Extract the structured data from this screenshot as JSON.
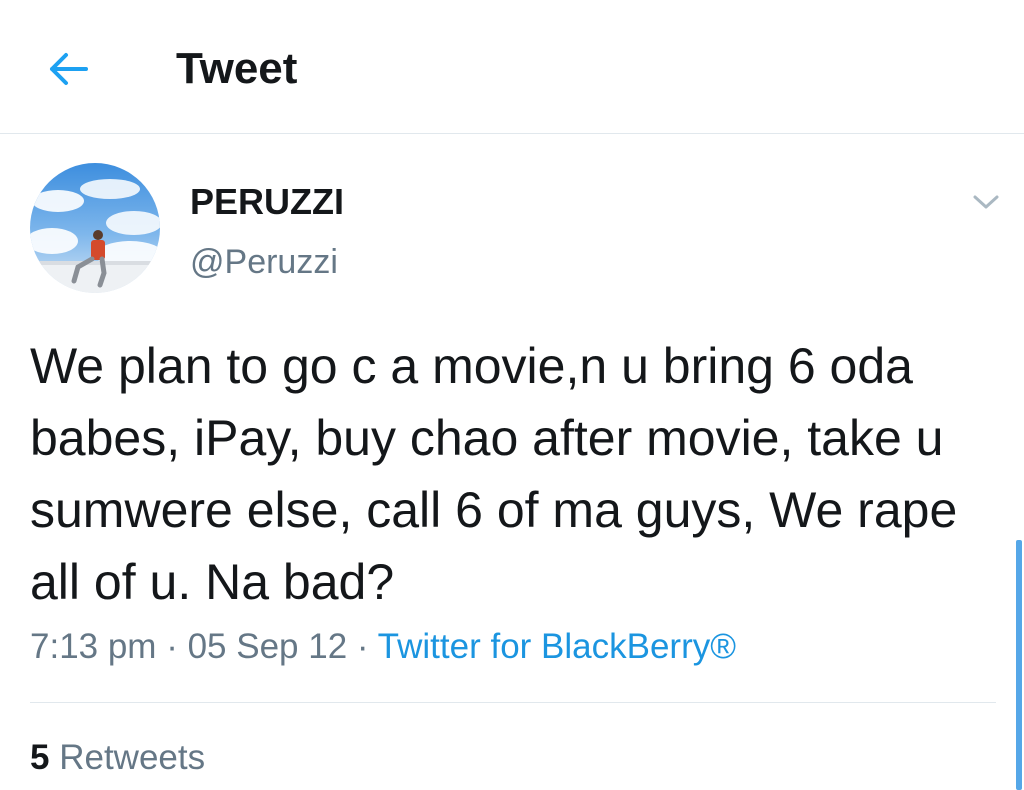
{
  "header": {
    "back_icon": "arrow-left-icon",
    "title": "Tweet",
    "accent_color": "#1da1f2"
  },
  "tweet": {
    "author": {
      "name": "PERUZZI",
      "handle": "@Peruzzi",
      "avatar": "profile-photo-sky-clouds"
    },
    "menu_icon": "chevron-down-icon",
    "text": "We plan to go c a movie,n u bring 6 oda babes, iPay, buy chao after movie, take u sumwere else, call 6 of ma guys, We rape all of u. Na bad?",
    "time": "7:13 pm",
    "separator": "·",
    "date": "05 Sep 12",
    "source": "Twitter for BlackBerry®"
  },
  "stats": {
    "retweets_count": "5",
    "retweets_label": "Retweets"
  }
}
